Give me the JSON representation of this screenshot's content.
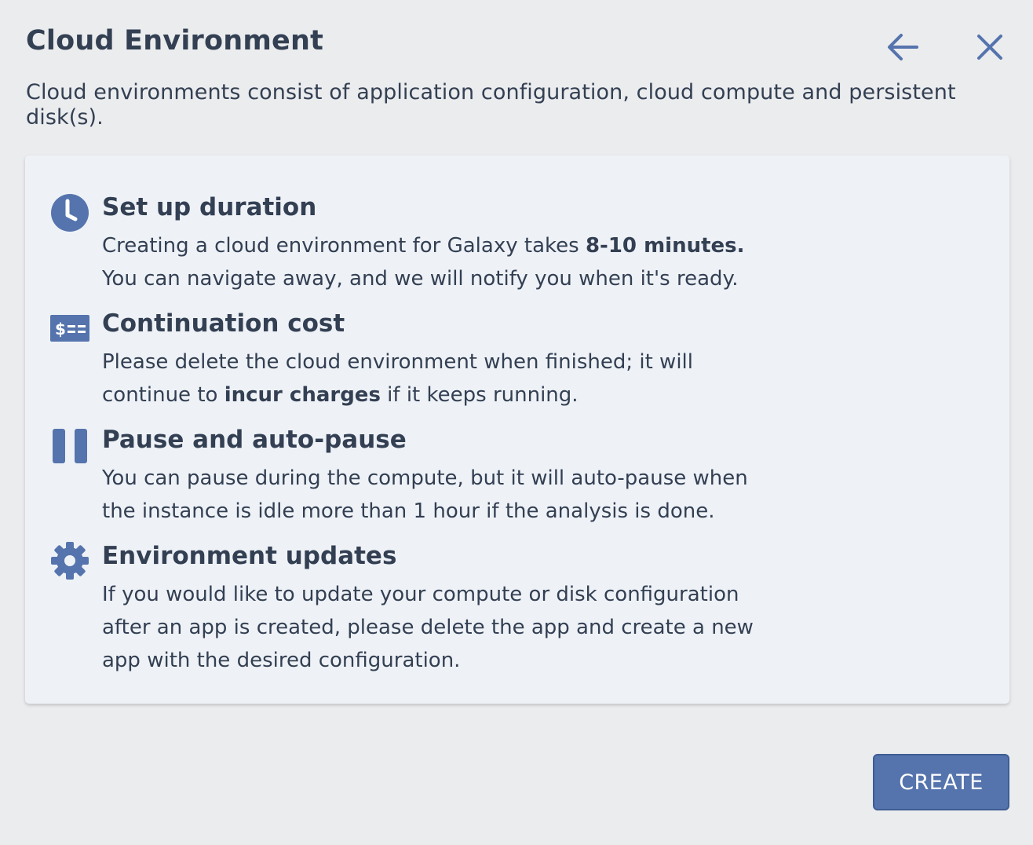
{
  "header": {
    "title": "Cloud Environment",
    "back_icon": "arrow-left-icon",
    "close_icon": "close-icon"
  },
  "subtitle": "Cloud environments consist of application configuration, cloud compute and persistent disk(s).",
  "colors": {
    "background": "#ebecee",
    "card": "#eef2f7",
    "accent": "#5574ad",
    "text": "#333f52"
  },
  "items": [
    {
      "icon": "clock-icon",
      "title": "Set up duration",
      "line1_pre": "Creating a cloud environment for Galaxy takes ",
      "line1_bold": "8-10 minutes.",
      "line2": "You can navigate away, and we will notify you when it's ready."
    },
    {
      "icon": "billing-icon",
      "title": "Continuation cost",
      "line1": "Please delete the cloud environment when finished; it will",
      "line2_pre": "continue to ",
      "line2_bold": "incur charges",
      "line2_post": " if it keeps running."
    },
    {
      "icon": "pause-icon",
      "title": "Pause and auto-pause",
      "line1": "You can pause during the compute, but it will auto-pause when",
      "line2": "the instance is idle more than 1 hour if the analysis is done."
    },
    {
      "icon": "gear-icon",
      "title": "Environment updates",
      "line1": "If you would like to update your compute or disk configuration",
      "line2": "after an app is created, please delete the app and create a new",
      "line3": "app with the desired configuration."
    }
  ],
  "footer": {
    "create_label": "CREATE"
  }
}
